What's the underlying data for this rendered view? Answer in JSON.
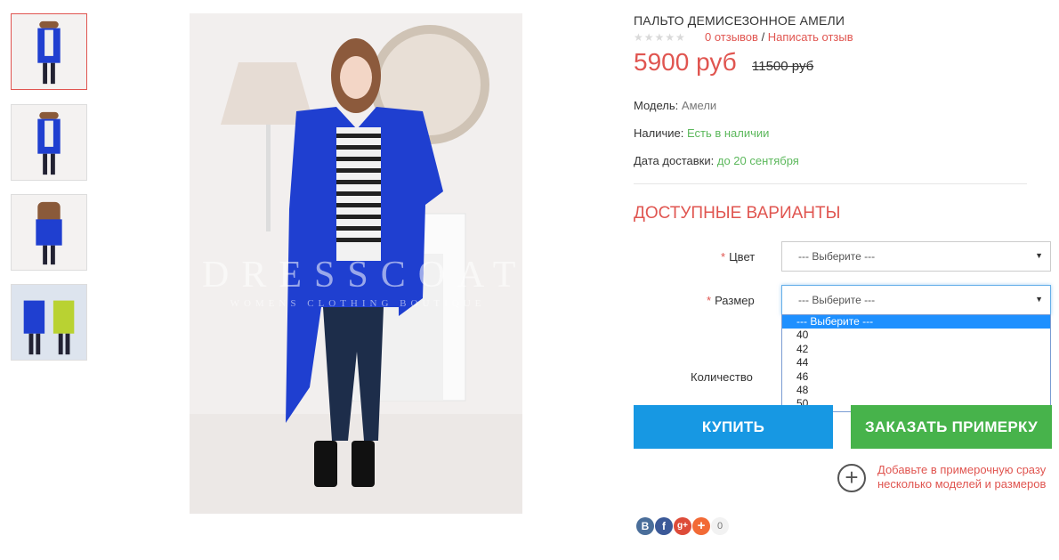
{
  "product": {
    "title": "ПАЛЬТО ДЕМИСЕЗОННОЕ АМЕЛИ",
    "stars": "★★★★★",
    "reviews_count": "0 отзывов",
    "reviews_sep": " / ",
    "write_review": "Написать отзыв",
    "price": "5900 руб",
    "old_price": "11500 руб"
  },
  "image": {
    "watermark_main": "DRESSCOAT",
    "watermark_sub": "WOMENS CLOTHING BOUTIQUE"
  },
  "meta": {
    "model_label": "Модель:",
    "model_value": "Амели",
    "stock_label": "Наличие:",
    "stock_value": "Есть в наличии",
    "delivery_label": "Дата доставки:",
    "delivery_value": "до 20 сентября"
  },
  "variants": {
    "title": "ДОСТУПНЫЕ ВАРИАНТЫ",
    "required_mark": "*",
    "color_label": "Цвет",
    "color_value": "--- Выберите ---",
    "size_label": "Размер",
    "size_value": "--- Выберите ---",
    "size_options": [
      "--- Выберите ---",
      "40",
      "42",
      "44",
      "46",
      "48",
      "50"
    ],
    "quantity_label": "Количество"
  },
  "buttons": {
    "buy": "КУПИТЬ",
    "try_on": "ЗАКАЗАТЬ ПРИМЕРКУ",
    "plus": "+",
    "try_note": "Добавьте в примерочную сразу несколько моделей и размеров"
  },
  "share": {
    "vk": "B",
    "fb": "f",
    "gplus": "g+",
    "more": "+",
    "count": "0"
  },
  "colors": {
    "accent": "#e05550",
    "buy": "#1798e3",
    "try_on": "#47b34b",
    "coat": "#1f3fd0"
  }
}
